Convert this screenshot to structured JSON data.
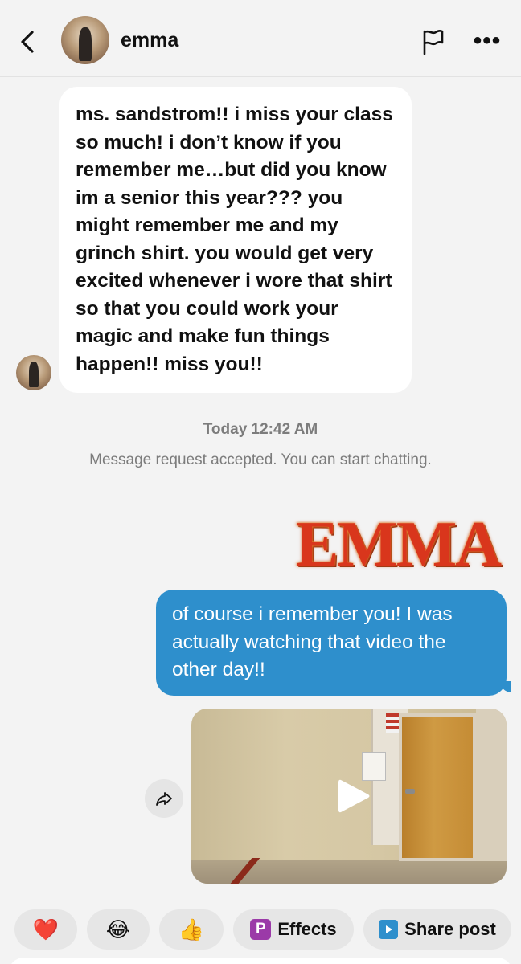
{
  "header": {
    "title": "emma",
    "back_icon": "chevron-left-icon",
    "flag_icon": "flag-icon",
    "more_label": "•••"
  },
  "incoming": {
    "text": "ms. sandstrom!! i miss your class so much! i don’t know if you remember me…but did you know im a senior this year??? you might remember me and my grinch shirt. you would get very excited whenever i wore that shirt so that you could work your magic and make fun things happen!! miss you!!"
  },
  "timestamp": "Today 12:42 AM",
  "system_message": "Message request accepted. You can start chatting.",
  "sticker": {
    "text": "EMMA"
  },
  "outgoing": {
    "text": "of course i remember you! I was actually watching that video the other day!!"
  },
  "video": {
    "play_icon": "play-icon",
    "share_icon": "share-arrow-icon"
  },
  "reactions": {
    "heart": "❤️",
    "laugh": "😂",
    "thumbs_up": "👍",
    "effects_icon": "P",
    "effects_label": "Effects",
    "share_label": "Share post"
  },
  "colors": {
    "outgoing_bubble": "#2e8fcc",
    "incoming_bubble": "#ffffff",
    "background": "#f3f3f3",
    "chip": "#e6e6e6"
  }
}
